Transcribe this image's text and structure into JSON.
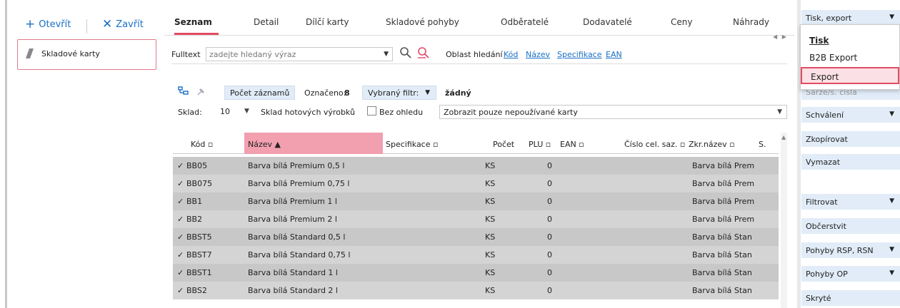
{
  "left": {
    "open_label": "Otevřít",
    "close_label": "Zavřít",
    "card_title": "Skladové karty"
  },
  "tabs": [
    {
      "label": "Seznam",
      "active": true
    },
    {
      "label": "Detail"
    },
    {
      "label": "Dílčí karty"
    },
    {
      "label": "Skladové pohyby"
    },
    {
      "label": "Odběratelé"
    },
    {
      "label": "Dodavatelé"
    },
    {
      "label": "Ceny"
    },
    {
      "label": "Náhrady"
    }
  ],
  "search": {
    "label": "Fulltext",
    "placeholder": "zadejte hledaný výraz",
    "area_label": "Oblast hledání",
    "links": [
      "Kód",
      "Název",
      "Specifikace",
      "EAN"
    ]
  },
  "filter": {
    "count_button": "Počet záznamů",
    "marked_label": "Označeno:",
    "marked_value": "8",
    "filter_select": "Vybraný filtr:",
    "filter_value": "žádný",
    "warehouse_label": "Sklad:",
    "warehouse_value": "10",
    "warehouse_name": "Sklad hotových výrobků",
    "regardless_label": "Bez ohledu",
    "show_select": "Zobrazit pouze nepoužívané karty"
  },
  "grid": {
    "columns": [
      "Kód",
      "Název",
      "Specifikace",
      "Počet",
      "PLU",
      "EAN",
      "Číslo cel. saz.",
      "Zkr.název",
      "S."
    ],
    "rows": [
      {
        "code": "BB05",
        "name": "Barva bílá Premium 0,5 l",
        "unit": "KS",
        "plu": "0",
        "short": "Barva bílá Prem"
      },
      {
        "code": "BB075",
        "name": "Barva bílá Premium 0,75 l",
        "unit": "KS",
        "plu": "0",
        "short": "Barva bílá Prem"
      },
      {
        "code": "BB1",
        "name": "Barva bílá Premium 1 l",
        "unit": "KS",
        "plu": "0",
        "short": "Barva bílá Prem"
      },
      {
        "code": "BB2",
        "name": "Barva bílá Premium 2 l",
        "unit": "KS",
        "plu": "0",
        "short": "Barva bílá Prem"
      },
      {
        "code": "BBST5",
        "name": "Barva bílá Standard 0,5 l",
        "unit": "KS",
        "plu": "0",
        "short": "Barva bílá Stan"
      },
      {
        "code": "BBST7",
        "name": "Barva bílá Standard 0,75 l",
        "unit": "KS",
        "plu": "0",
        "short": "Barva bílá Stan"
      },
      {
        "code": "BBST1",
        "name": "Barva bílá Standard 1 l",
        "unit": "KS",
        "plu": "0",
        "short": "Barva bílá Stan"
      },
      {
        "code": "BBS2",
        "name": "Barva bílá Standard 2 l",
        "unit": "KS",
        "plu": "0",
        "short": "Barva bílá Stan"
      }
    ]
  },
  "right": {
    "print_export": "Tisk, export",
    "obscured_label": "Šarže/s. čísla",
    "approval": "Schválení",
    "copy": "Zkopírovat",
    "delete": "Vymazat",
    "filter": "Filtrovat",
    "refresh": "Občerstvit",
    "moves_rsp": "Pohyby RSP, RSN",
    "moves_op": "Pohyby OP",
    "hidden": "Skryté"
  },
  "dropdown": {
    "items": [
      "Tisk",
      "B2B Export",
      "Export"
    ]
  },
  "colors": {
    "accent": "#e34b63",
    "link": "#1a6fc4",
    "button_bg": "#e1ecf8",
    "row_even": "#c8c8c8",
    "row_odd": "#d4d4d4"
  }
}
